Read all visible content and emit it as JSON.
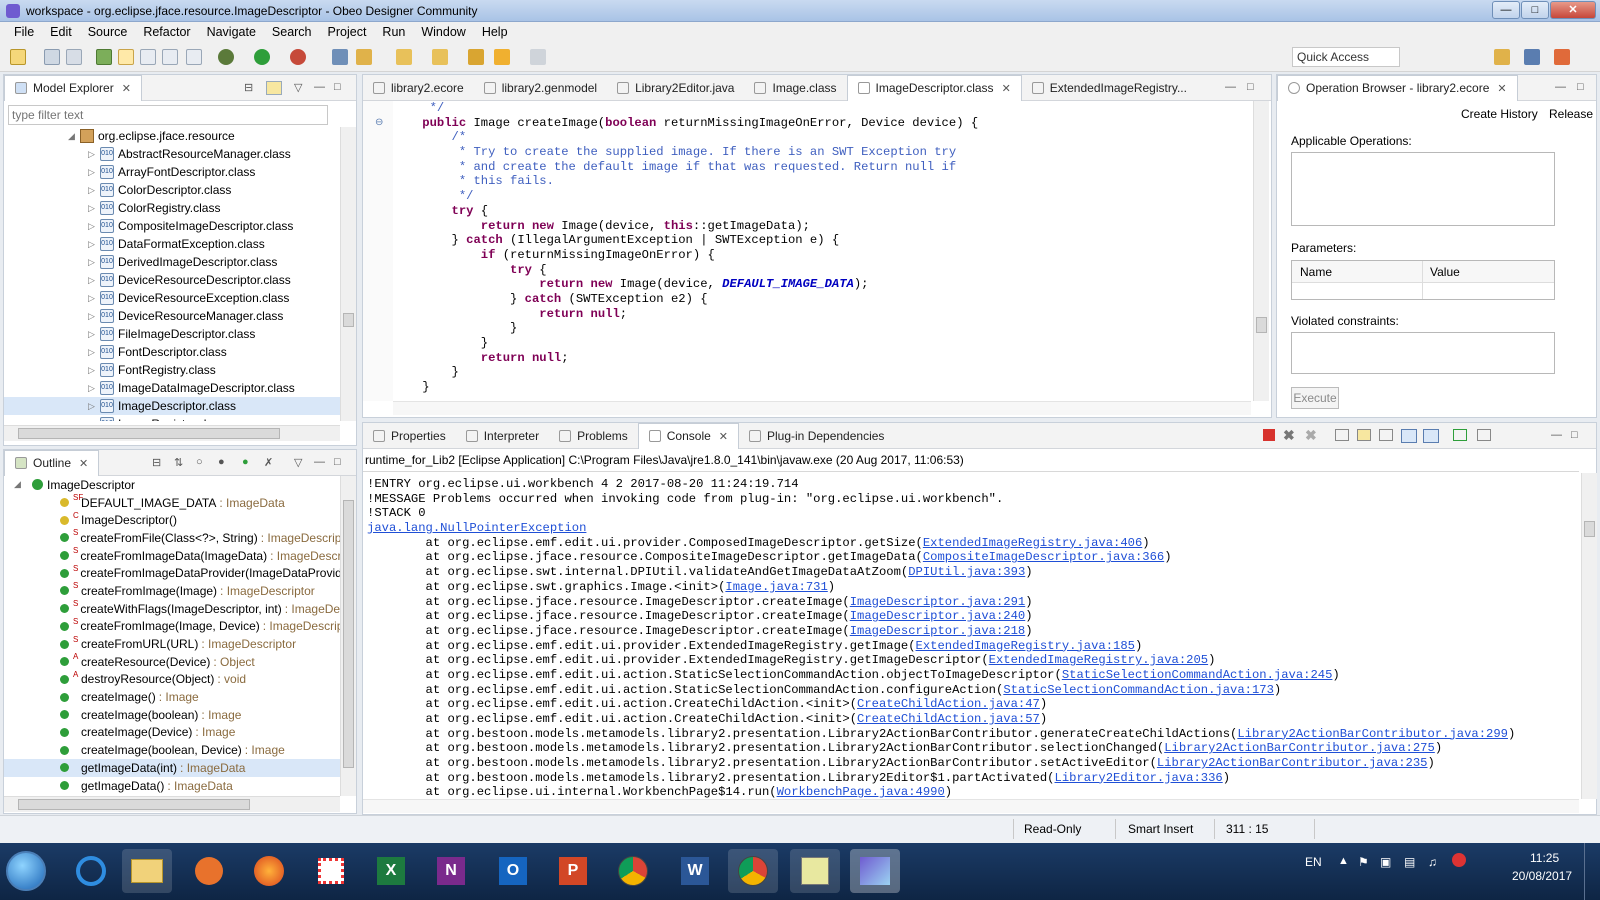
{
  "window": {
    "title": "workspace - org.eclipse.jface.resource.ImageDescriptor - Obeo Designer Community"
  },
  "menu": [
    "File",
    "Edit",
    "Source",
    "Refactor",
    "Navigate",
    "Search",
    "Project",
    "Run",
    "Window",
    "Help"
  ],
  "toolbar": {
    "quick_access": "Quick Access"
  },
  "model_explorer": {
    "tab": "Model Explorer",
    "filter_placeholder": "type filter text",
    "package": "org.eclipse.jface.resource",
    "items": [
      "AbstractResourceManager.class",
      "ArrayFontDescriptor.class",
      "ColorDescriptor.class",
      "ColorRegistry.class",
      "CompositeImageDescriptor.class",
      "DataFormatException.class",
      "DerivedImageDescriptor.class",
      "DeviceResourceDescriptor.class",
      "DeviceResourceException.class",
      "DeviceResourceManager.class",
      "FileImageDescriptor.class",
      "FontDescriptor.class",
      "FontRegistry.class",
      "ImageDataImageDescriptor.class",
      "ImageDescriptor.class",
      "ImageRegistry.class"
    ]
  },
  "outline": {
    "tab": "Outline",
    "root": "ImageDescriptor",
    "items": [
      {
        "name": "DEFAULT_IMAGE_DATA",
        "type": " : ImageData",
        "mod": "SF"
      },
      {
        "name": "ImageDescriptor()",
        "type": "",
        "mod": "C"
      },
      {
        "name": "createFromFile(Class<?>, String)",
        "type": " : ImageDescripto",
        "mod": "S"
      },
      {
        "name": "createFromImageData(ImageData)",
        "type": " : ImageDescrip",
        "mod": "S"
      },
      {
        "name": "createFromImageDataProvider(ImageDataProvide",
        "type": "",
        "mod": "S"
      },
      {
        "name": "createFromImage(Image)",
        "type": " : ImageDescriptor",
        "mod": "S"
      },
      {
        "name": "createWithFlags(ImageDescriptor, int)",
        "type": " : ImageDes",
        "mod": "S"
      },
      {
        "name": "createFromImage(Image, Device)",
        "type": " : ImageDescript",
        "mod": "S"
      },
      {
        "name": "createFromURL(URL)",
        "type": " : ImageDescriptor",
        "mod": "S"
      },
      {
        "name": "createResource(Device)",
        "type": " : Object",
        "mod": "A"
      },
      {
        "name": "destroyResource(Object)",
        "type": " : void",
        "mod": "A"
      },
      {
        "name": "createImage()",
        "type": " : Image",
        "mod": ""
      },
      {
        "name": "createImage(boolean)",
        "type": " : Image",
        "mod": ""
      },
      {
        "name": "createImage(Device)",
        "type": " : Image",
        "mod": ""
      },
      {
        "name": "createImage(boolean, Device)",
        "type": " : Image",
        "mod": ""
      },
      {
        "name": "getImageData(int)",
        "type": " : ImageData",
        "mod": ""
      },
      {
        "name": "getImageData()",
        "type": " : ImageData",
        "mod": ""
      }
    ]
  },
  "editor": {
    "tabs": [
      "library2.ecore",
      "library2.genmodel",
      "Library2Editor.java",
      "Image.class",
      "ImageDescriptor.class",
      "ExtendedImageRegistry..."
    ],
    "active_tab": 4,
    "lines": [
      "     */",
      "    public Image createImage(boolean returnMissingImageOnError, Device device) {",
      "        /*",
      "         * Try to create the supplied image. If there is an SWT Exception try",
      "         * and create the default image if that was requested. Return null if",
      "         * this fails.",
      "         */",
      "        try {",
      "            return new Image(device, this::getImageData);",
      "        } catch (IllegalArgumentException | SWTException e) {",
      "            if (returnMissingImageOnError) {",
      "                try {",
      "                    return new Image(device, DEFAULT_IMAGE_DATA);",
      "                } catch (SWTException e2) {",
      "                    return null;",
      "                }",
      "            }",
      "            return null;",
      "        }",
      "    }"
    ]
  },
  "operation_browser": {
    "tab": "Operation Browser - library2.ecore",
    "create_history": "Create History",
    "release": "Release",
    "applicable_label": "Applicable Operations:",
    "parameters_label": "Parameters:",
    "col_name": "Name",
    "col_value": "Value",
    "violated_label": "Violated constraints:",
    "execute": "Execute"
  },
  "console": {
    "tabs": [
      "Properties",
      "Interpreter",
      "Problems",
      "Console",
      "Plug-in Dependencies"
    ],
    "active_tab": 3,
    "header": "runtime_for_Lib2 [Eclipse Application] C:\\Program Files\\Java\\jre1.8.0_141\\bin\\javaw.exe (20 Aug 2017, 11:06:53)",
    "top_lines": [
      "!ENTRY org.eclipse.ui.workbench 4 2 2017-08-20 11:24:19.714",
      "!MESSAGE Problems occurred when invoking code from plug-in: \"org.eclipse.ui.workbench\".",
      "!STACK 0"
    ],
    "exception": "java.lang.NullPointerException",
    "stack": [
      {
        "text": "at org.eclipse.emf.edit.ui.provider.ComposedImageDescriptor.getSize(",
        "link": "ExtendedImageRegistry.java:406"
      },
      {
        "text": "at org.eclipse.jface.resource.CompositeImageDescriptor.getImageData(",
        "link": "CompositeImageDescriptor.java:366"
      },
      {
        "text": "at org.eclipse.swt.internal.DPIUtil.validateAndGetImageDataAtZoom(",
        "link": "DPIUtil.java:393"
      },
      {
        "text": "at org.eclipse.swt.graphics.Image.<init>(",
        "link": "Image.java:731"
      },
      {
        "text": "at org.eclipse.jface.resource.ImageDescriptor.createImage(",
        "link": "ImageDescriptor.java:291"
      },
      {
        "text": "at org.eclipse.jface.resource.ImageDescriptor.createImage(",
        "link": "ImageDescriptor.java:240"
      },
      {
        "text": "at org.eclipse.jface.resource.ImageDescriptor.createImage(",
        "link": "ImageDescriptor.java:218"
      },
      {
        "text": "at org.eclipse.emf.edit.ui.provider.ExtendedImageRegistry.getImage(",
        "link": "ExtendedImageRegistry.java:185"
      },
      {
        "text": "at org.eclipse.emf.edit.ui.provider.ExtendedImageRegistry.getImageDescriptor(",
        "link": "ExtendedImageRegistry.java:205"
      },
      {
        "text": "at org.eclipse.emf.edit.ui.action.StaticSelectionCommandAction.objectToImageDescriptor(",
        "link": "StaticSelectionCommandAction.java:245"
      },
      {
        "text": "at org.eclipse.emf.edit.ui.action.StaticSelectionCommandAction.configureAction(",
        "link": "StaticSelectionCommandAction.java:173"
      },
      {
        "text": "at org.eclipse.emf.edit.ui.action.CreateChildAction.<init>(",
        "link": "CreateChildAction.java:47"
      },
      {
        "text": "at org.eclipse.emf.edit.ui.action.CreateChildAction.<init>(",
        "link": "CreateChildAction.java:57"
      },
      {
        "text": "at org.bestoon.models.metamodels.library2.presentation.Library2ActionBarContributor.generateCreateChildActions(",
        "link": "Library2ActionBarContributor.java:299"
      },
      {
        "text": "at org.bestoon.models.metamodels.library2.presentation.Library2ActionBarContributor.selectionChanged(",
        "link": "Library2ActionBarContributor.java:275"
      },
      {
        "text": "at org.bestoon.models.metamodels.library2.presentation.Library2ActionBarContributor.setActiveEditor(",
        "link": "Library2ActionBarContributor.java:235"
      },
      {
        "text": "at org.bestoon.models.metamodels.library2.presentation.Library2Editor$1.partActivated(",
        "link": "Library2Editor.java:336"
      },
      {
        "text": "at org.eclipse.ui.internal.WorkbenchPage$14.run(",
        "link": "WorkbenchPage.java:4990"
      }
    ]
  },
  "status": {
    "mode": "Read-Only",
    "insert": "Smart Insert",
    "position": "311 : 15"
  },
  "taskbar": {
    "lang": "EN",
    "time": "11:25",
    "date": "20/08/2017"
  },
  "colors": {
    "keyword": "#7f0055",
    "comment": "#3f5fbf",
    "constant": "#0000c0",
    "link": "#1f4fd6"
  }
}
